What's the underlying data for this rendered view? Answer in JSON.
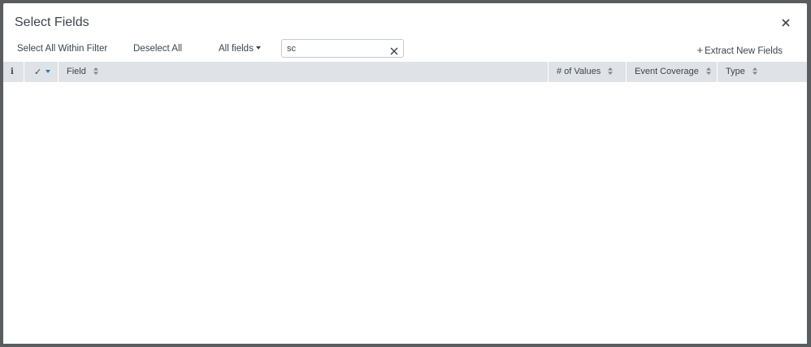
{
  "modal": {
    "title": "Select Fields"
  },
  "toolbar": {
    "select_all_label": "Select All Within Filter",
    "deselect_all_label": "Deselect All",
    "filter_dropdown_label": "All fields",
    "search_value": "sc",
    "extract_label": "Extract New Fields",
    "extract_prefix": "+"
  },
  "table": {
    "columns": {
      "info": "i",
      "check": "✓",
      "field": "Field",
      "values": "# of Values",
      "coverage": "Event Coverage",
      "type": "Type"
    },
    "rows": []
  },
  "icons": {
    "close": "close-icon",
    "clear": "clear-icon",
    "sort": "sort-icon",
    "caret": "caret-down-icon"
  },
  "colors": {
    "header_bg": "#dfe3e7",
    "text": "#3c444d",
    "accent": "#1a7dc2",
    "backdrop": "#5a5d60"
  }
}
